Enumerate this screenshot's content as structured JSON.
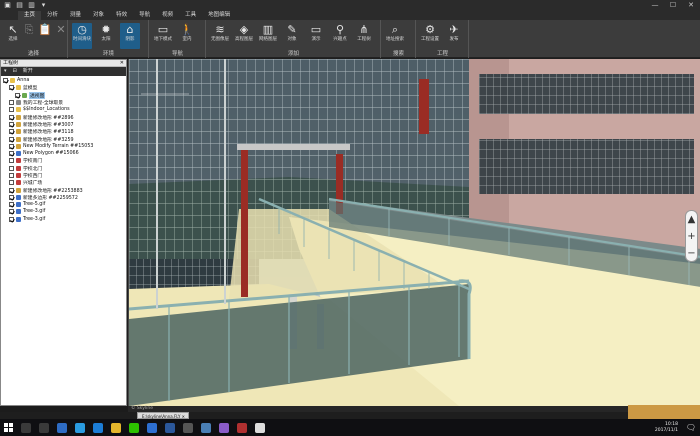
{
  "titlebar": {
    "quick_access_icons": [
      "folder-icon",
      "save-icon",
      "save-as-icon",
      "dropdown-icon"
    ],
    "controls": {
      "minimize": "—",
      "maximize": "☐",
      "close": "✕"
    }
  },
  "menu": {
    "tabs": [
      {
        "label": "主页",
        "active": true
      },
      {
        "label": "分析",
        "active": false
      },
      {
        "label": "测量",
        "active": false
      },
      {
        "label": "对象",
        "active": false
      },
      {
        "label": "特效",
        "active": false
      },
      {
        "label": "导航",
        "active": false
      },
      {
        "label": "视频",
        "active": false
      },
      {
        "label": "工具",
        "active": false
      },
      {
        "label": "地图编辑",
        "active": false
      }
    ]
  },
  "ribbon": {
    "groups": [
      {
        "label": "选择",
        "buttons": [
          {
            "label": "选择",
            "icon": "pointer-icon",
            "glyph": "↖"
          },
          {
            "label": "",
            "icon": "copy-icon",
            "glyph": "⎘",
            "dim": true
          },
          {
            "label": "",
            "icon": "paste-icon",
            "glyph": "📋",
            "dim": true
          },
          {
            "label": "",
            "icon": "delete-icon",
            "glyph": "✕",
            "dim": true
          }
        ]
      },
      {
        "label": "环境",
        "buttons": [
          {
            "label": "时间滑块",
            "icon": "clock-icon",
            "glyph": "◷",
            "highlight": true
          },
          {
            "label": "太阳",
            "icon": "sun-icon",
            "glyph": "✹"
          },
          {
            "label": "阴影",
            "icon": "shadow-icon",
            "glyph": "⌂",
            "highlight": true
          }
        ]
      },
      {
        "label": "导航",
        "buttons": [
          {
            "label": "地下模式",
            "icon": "underground-icon",
            "glyph": "▭"
          },
          {
            "label": "室内",
            "icon": "walk-icon",
            "glyph": "🚶"
          }
        ]
      },
      {
        "label": "添加",
        "buttons": [
          {
            "label": "无图像层",
            "icon": "layers-icon",
            "glyph": "≋"
          },
          {
            "label": "高程图层",
            "icon": "elevation-layers-icon",
            "glyph": "◈"
          },
          {
            "label": "网络图层",
            "icon": "network-layer-icon",
            "glyph": "▥"
          },
          {
            "label": "对象",
            "icon": "object-icon",
            "glyph": "✎"
          },
          {
            "label": "演示",
            "icon": "presentation-icon",
            "glyph": "▭"
          },
          {
            "label": "兴趣点",
            "icon": "pin-icon",
            "glyph": "⚲"
          },
          {
            "label": "工程树",
            "icon": "tree-icon",
            "glyph": "⋔"
          }
        ]
      },
      {
        "label": "搜索",
        "buttons": [
          {
            "label": "地址搜索",
            "icon": "search-icon",
            "glyph": "⌕"
          }
        ]
      },
      {
        "label": "工程",
        "buttons": [
          {
            "label": "工程设置",
            "icon": "gear-icon",
            "glyph": "⚙"
          },
          {
            "label": "发布",
            "icon": "publish-icon",
            "glyph": "✈"
          }
        ]
      }
    ]
  },
  "projecttree": {
    "title": "工程树",
    "close": "✕",
    "toolbar": [
      "▾",
      "⊟",
      "新开"
    ],
    "nodes": [
      {
        "label": "Anna",
        "depth": 0,
        "checked": true,
        "expand": "⊟",
        "icon_color": "#e8c14a"
      },
      {
        "label": "蓝模型",
        "depth": 1,
        "checked": true,
        "expand": "⊟",
        "icon_color": "#e8c14a"
      },
      {
        "label": "透视图",
        "depth": 2,
        "checked": true,
        "expand": "",
        "icon_color": "#6aa84f",
        "selected": true
      },
      {
        "label": "我的工程-全球取景",
        "depth": 1,
        "checked": false,
        "expand": "",
        "icon_color": "#888888"
      },
      {
        "label": "$$Indoor_Locations",
        "depth": 1,
        "checked": false,
        "expand": "",
        "icon_color": "#e8c14a"
      },
      {
        "label": "新建修改地形 ##2896",
        "depth": 1,
        "checked": true,
        "expand": "",
        "icon_color": "#d1a33a"
      },
      {
        "label": "新建修改地形 ##3007",
        "depth": 1,
        "checked": true,
        "expand": "",
        "icon_color": "#d1a33a"
      },
      {
        "label": "新建修改地形 ##3118",
        "depth": 1,
        "checked": true,
        "expand": "",
        "icon_color": "#d1a33a"
      },
      {
        "label": "新建修改地形 ##3259",
        "depth": 1,
        "checked": true,
        "expand": "",
        "icon_color": "#d1a33a"
      },
      {
        "label": "New Modify Terrain ##15053",
        "depth": 1,
        "checked": true,
        "expand": "",
        "icon_color": "#d1a33a"
      },
      {
        "label": "New Polygon ##15066",
        "depth": 1,
        "checked": true,
        "expand": "",
        "icon_color": "#3d6fc8"
      },
      {
        "label": "学校南门",
        "depth": 1,
        "checked": false,
        "expand": "",
        "icon_color": "#c23b3b"
      },
      {
        "label": "学校北门",
        "depth": 1,
        "checked": false,
        "expand": "",
        "icon_color": "#c23b3b"
      },
      {
        "label": "学校西门",
        "depth": 1,
        "checked": false,
        "expand": "",
        "icon_color": "#c23b3b"
      },
      {
        "label": "兴城广场",
        "depth": 1,
        "checked": false,
        "expand": "",
        "icon_color": "#c23b3b"
      },
      {
        "label": "新建修改地形 ##2253883",
        "depth": 1,
        "checked": true,
        "expand": "",
        "icon_color": "#d1a33a"
      },
      {
        "label": "新建多边形 ##2259572",
        "depth": 1,
        "checked": true,
        "expand": "",
        "icon_color": "#3d6fc8"
      },
      {
        "label": "Tree-5.gif",
        "depth": 1,
        "checked": true,
        "expand": "",
        "icon_color": "#3d6fc8"
      },
      {
        "label": "Tree-3.gif",
        "depth": 1,
        "checked": true,
        "expand": "",
        "icon_color": "#3d6fc8"
      },
      {
        "label": "Tree-3.gif",
        "depth": 1,
        "checked": true,
        "expand": "",
        "icon_color": "#3d6fc8"
      }
    ]
  },
  "viewport": {
    "nav_buttons": {
      "up": "▲",
      "zoom_in": "+",
      "zoom_out": "−"
    },
    "status": "© Skyline"
  },
  "documenttab": {
    "label": "E:\\skyline\\Anna.FLY ✕"
  },
  "taskbar": {
    "icons": [
      {
        "name": "search-icon",
        "color": "#3a3a3a"
      },
      {
        "name": "task-view-icon",
        "color": "#3a3a3a"
      },
      {
        "name": "browser-icon",
        "color": "#2e6cc4"
      },
      {
        "name": "qq-icon",
        "color": "#2a9be0"
      },
      {
        "name": "edge-icon",
        "color": "#1c7dd6"
      },
      {
        "name": "explorer-icon",
        "color": "#e5b62c"
      },
      {
        "name": "wechat-icon",
        "color": "#2dc100"
      },
      {
        "name": "mail-icon",
        "color": "#2d6fd1"
      },
      {
        "name": "word-icon",
        "color": "#2b579a"
      },
      {
        "name": "store-icon",
        "color": "#555555"
      },
      {
        "name": "skyline-icon",
        "color": "#4a7fb5"
      },
      {
        "name": "photos-icon",
        "color": "#8b5cc8"
      },
      {
        "name": "media-icon",
        "color": "#b03030"
      },
      {
        "name": "misc-icon",
        "color": "#dddddd"
      }
    ],
    "time": "10:18",
    "date": "2017/11/1",
    "notification_icon": "🗨"
  },
  "colors": {
    "ribbon_bg": "#3c3c3c",
    "highlight": "#1f5e8a",
    "floor": "#f5efc3",
    "pillar": "#9a2c24"
  }
}
